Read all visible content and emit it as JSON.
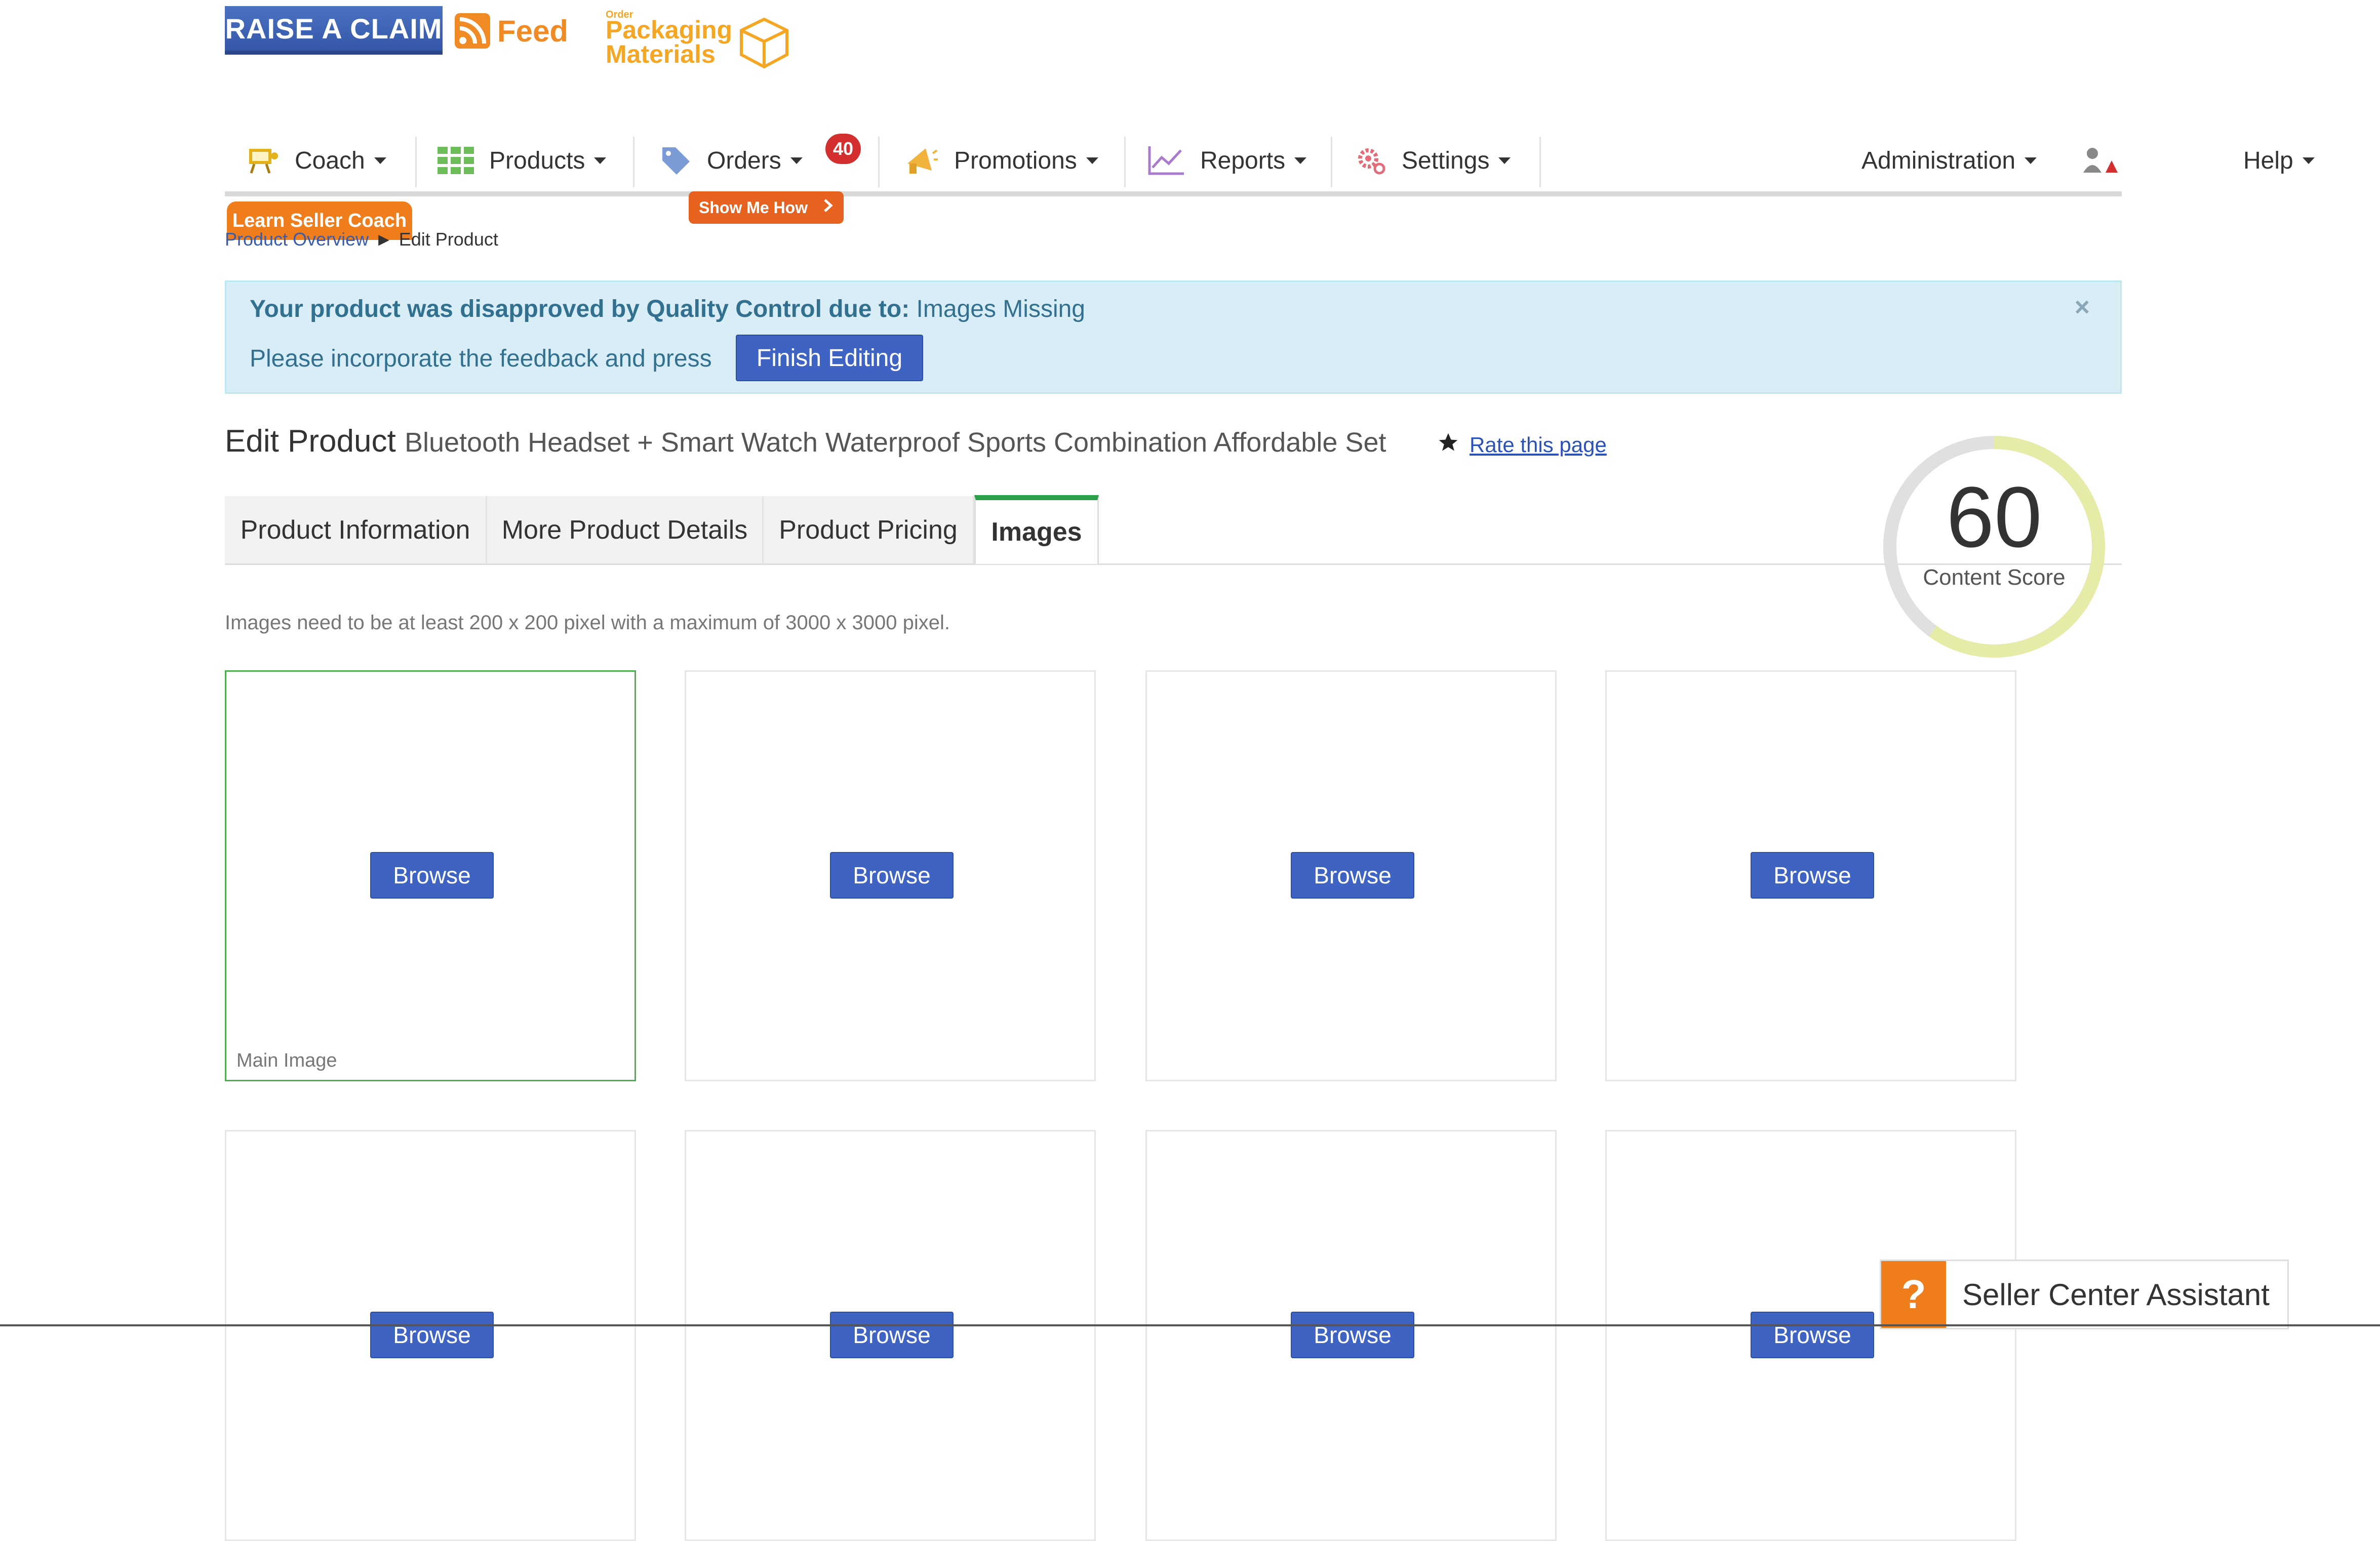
{
  "header": {
    "raise_claim": "RAISE A CLAIM",
    "feed": "Feed",
    "packaging_small": "Order",
    "packaging_line1": "Packaging",
    "packaging_line2": "Materials"
  },
  "nav": {
    "coach": "Coach",
    "products": "Products",
    "orders": "Orders",
    "orders_badge": "40",
    "promotions": "Promotions",
    "reports": "Reports",
    "settings": "Settings",
    "help": "Help",
    "administration": "Administration"
  },
  "learn_coach": "Learn Seller Coach",
  "show_me_how": "Show Me How",
  "breadcrumb": {
    "parent": "Product Overview",
    "separator": "►",
    "current": "Edit Product"
  },
  "alert": {
    "bold_text": "Your product was disapproved by Quality Control due to:",
    "reason": "Images Missing",
    "instruction": "Please incorporate the feedback and press",
    "button": "Finish Editing",
    "close": "×"
  },
  "page": {
    "title": "Edit Product",
    "product_name": "Bluetooth Headset + Smart Watch Waterproof Sports Combination Affordable Set",
    "rate_link": "Rate this page"
  },
  "tabs": [
    "Product Information",
    "More Product Details",
    "Product Pricing",
    "Images"
  ],
  "content_score": {
    "value": "60",
    "label": "Content Score",
    "fraction": 0.6
  },
  "images": {
    "hint": "Images need to be at least 200 x 200 pixel with a maximum of 3000 x 3000 pixel.",
    "browse": "Browse",
    "main_label": "Main Image"
  },
  "assistant": {
    "icon": "?",
    "label": "Seller Center Assistant"
  },
  "colors": {
    "accent_blue": "#3e63c3",
    "orange": "#f07d1b",
    "green_tab": "#2aa048",
    "alert_bg": "#d9edf7"
  }
}
